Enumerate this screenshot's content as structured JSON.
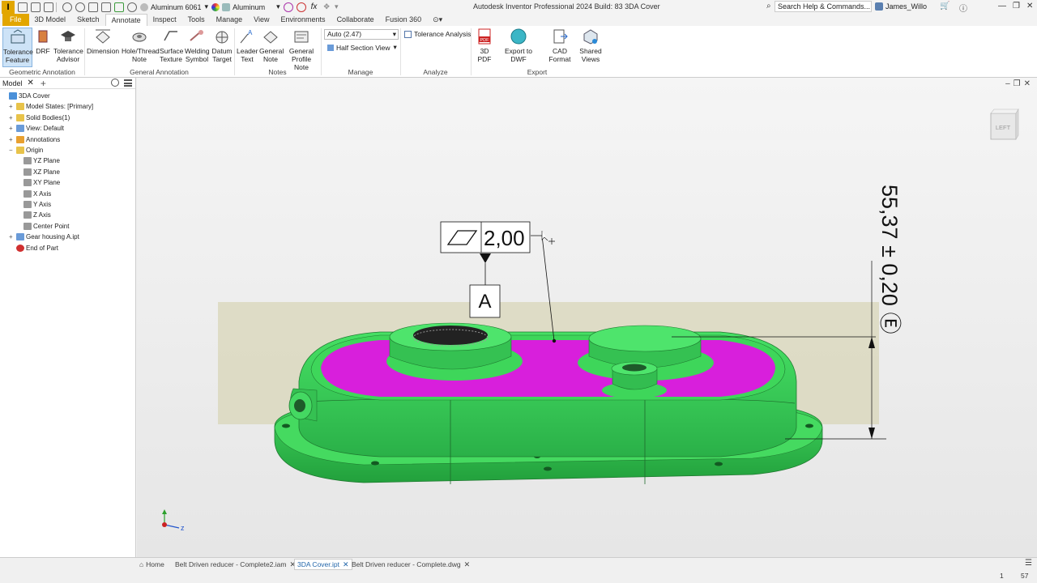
{
  "app": {
    "title": "Autodesk Inventor Professional 2024 Build: 83   3DA Cover",
    "logo_letter": "I",
    "material": "Aluminum 6061",
    "appearance": "Aluminum",
    "help_search": "Search Help & Commands...",
    "user": "James_Willo"
  },
  "tabs": [
    {
      "label": "File"
    },
    {
      "label": "3D Model"
    },
    {
      "label": "Sketch"
    },
    {
      "label": "Annotate"
    },
    {
      "label": "Inspect"
    },
    {
      "label": "Tools"
    },
    {
      "label": "Manage"
    },
    {
      "label": "View"
    },
    {
      "label": "Environments"
    },
    {
      "label": "Collaborate"
    },
    {
      "label": "Fusion 360"
    }
  ],
  "ribbon": {
    "buttons": [
      {
        "label1": "Tolerance",
        "label2": "Feature"
      },
      {
        "label1": "DRF",
        "label2": ""
      },
      {
        "label1": "Tolerance",
        "label2": "Advisor"
      },
      {
        "label1": "Dimension",
        "label2": ""
      },
      {
        "label1": "Hole/Thread",
        "label2": "Note"
      },
      {
        "label1": "Surface",
        "label2": "Texture"
      },
      {
        "label1": "Welding",
        "label2": "Symbol"
      },
      {
        "label1": "Datum",
        "label2": "Target"
      },
      {
        "label1": "Leader",
        "label2": "Text"
      },
      {
        "label1": "General",
        "label2": "Note"
      },
      {
        "label1": "General",
        "label2": "Profile Note"
      },
      {
        "label1": "3D PDF",
        "label2": ""
      },
      {
        "label1": "Export to DWF",
        "label2": ""
      },
      {
        "label1": "CAD Format",
        "label2": ""
      },
      {
        "label1": "Shared",
        "label2": "Views"
      }
    ],
    "manage_dropdown": "Auto (2.47)",
    "half_section": "Half Section View",
    "tolerance_analysis": "Tolerance Analysis",
    "panels": [
      "Geometric Annotation",
      "General Annotation",
      "Notes",
      "Manage",
      "Analyze",
      "Export"
    ]
  },
  "browser": {
    "title": "Model",
    "items": [
      {
        "label": "3DA Cover",
        "color": "#4a90d9"
      },
      {
        "label": "Model States: [Primary]",
        "color": "#e8c34a"
      },
      {
        "label": "Solid Bodies(1)",
        "color": "#e8c34a"
      },
      {
        "label": "View: Default",
        "color": "#6a9bd8"
      },
      {
        "label": "Annotations",
        "color": "#e8a030"
      },
      {
        "label": "Origin",
        "color": "#e8c34a"
      },
      {
        "label": "YZ Plane",
        "color": "#999999"
      },
      {
        "label": "XZ Plane",
        "color": "#999999"
      },
      {
        "label": "XY Plane",
        "color": "#999999"
      },
      {
        "label": "X Axis",
        "color": "#999999"
      },
      {
        "label": "Y Axis",
        "color": "#999999"
      },
      {
        "label": "Z Axis",
        "color": "#999999"
      },
      {
        "label": "Center Point",
        "color": "#999999"
      },
      {
        "label": "Gear housing A.ipt",
        "color": "#6a9bd8"
      },
      {
        "label": "End of Part",
        "color": "#d03030"
      }
    ]
  },
  "viewport": {
    "fcf_value": "2,00",
    "datum_label": "A",
    "dimension_text": "55,37 ± 0,20 Ⓔ",
    "viewcube_label": "LEFT",
    "axis_z": "z",
    "colors": {
      "body": "#3ed65a",
      "face": "#d81fdc",
      "plane": "#d8d6b8"
    }
  },
  "doctabs": {
    "home": "Home",
    "tabs": [
      {
        "label": "Belt Driven reducer - Complete2.iam"
      },
      {
        "label": "3DA Cover.ipt"
      },
      {
        "label": "Belt Driven reducer - Complete.dwg"
      }
    ]
  },
  "status": {
    "left": "1",
    "right": "57"
  }
}
